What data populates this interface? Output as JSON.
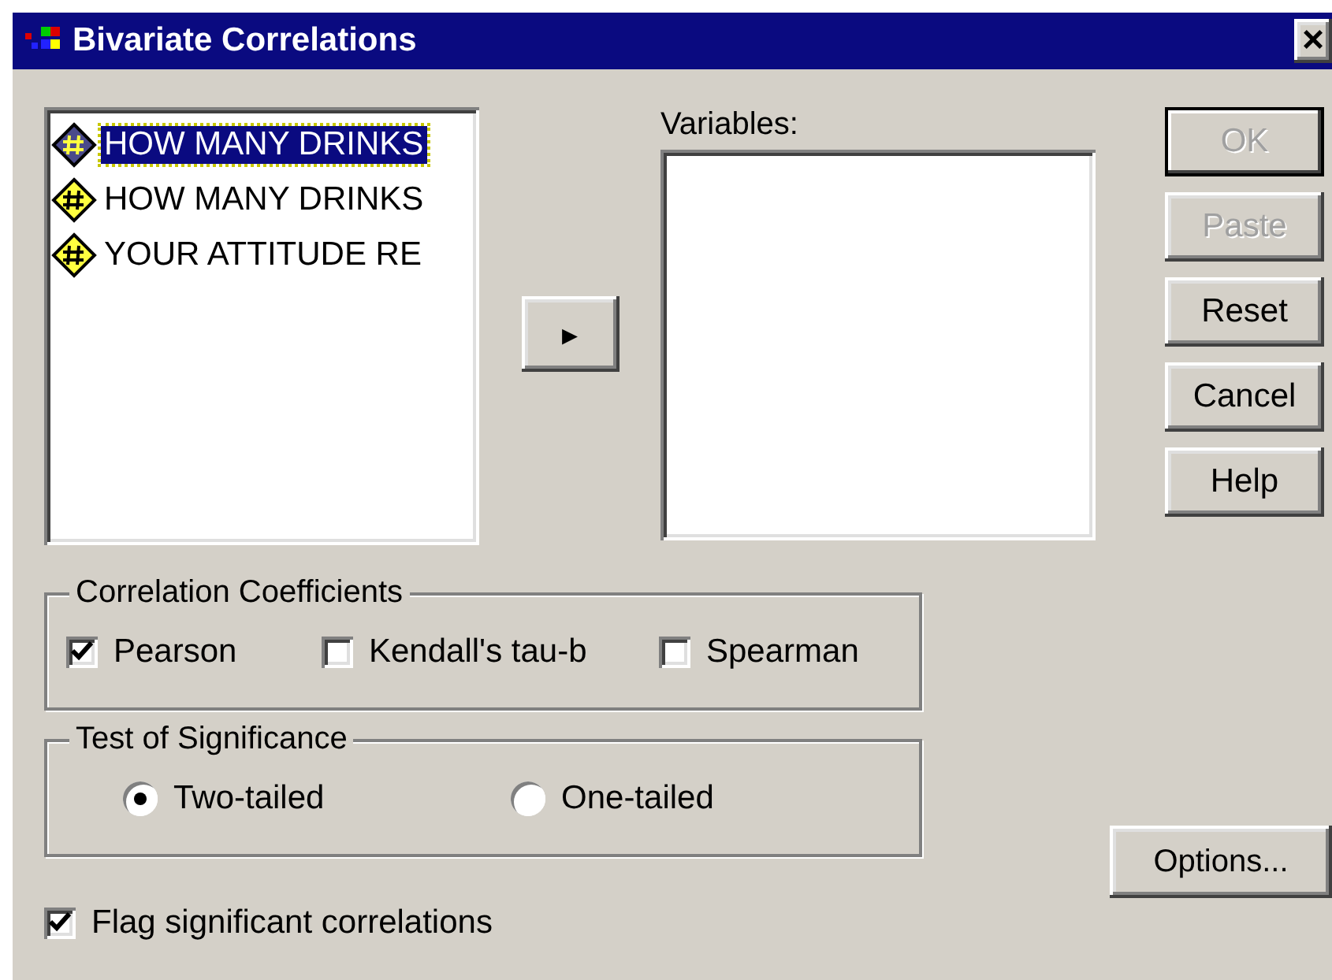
{
  "window": {
    "title": "Bivariate Correlations",
    "close": "×"
  },
  "source_list": {
    "items": [
      {
        "label": "HOW MANY DRINKS",
        "selected": true
      },
      {
        "label": "HOW MANY DRINKS",
        "selected": false
      },
      {
        "label": "YOUR ATTITUDE RE",
        "selected": false
      }
    ]
  },
  "move_button": {
    "glyph": "▸"
  },
  "variables": {
    "label": "Variables:"
  },
  "buttons": [
    {
      "label": "OK",
      "disabled": true,
      "default": true
    },
    {
      "label": "Paste",
      "disabled": true,
      "default": false
    },
    {
      "label": "Reset",
      "disabled": false,
      "default": false
    },
    {
      "label": "Cancel",
      "disabled": false,
      "default": false
    },
    {
      "label": "Help",
      "disabled": false,
      "default": false
    }
  ],
  "correlation_coefficients": {
    "title": "Correlation Coefficients",
    "options": [
      {
        "label": "Pearson",
        "checked": true
      },
      {
        "label": "Kendall's tau-b",
        "checked": false
      },
      {
        "label": "Spearman",
        "checked": false
      }
    ]
  },
  "test_of_significance": {
    "title": "Test of Significance",
    "options": [
      {
        "label": "Two-tailed",
        "selected": true
      },
      {
        "label": "One-tailed",
        "selected": false
      }
    ]
  },
  "flag": {
    "label": "Flag significant correlations",
    "checked": true
  },
  "options_button": {
    "label": "Options..."
  }
}
